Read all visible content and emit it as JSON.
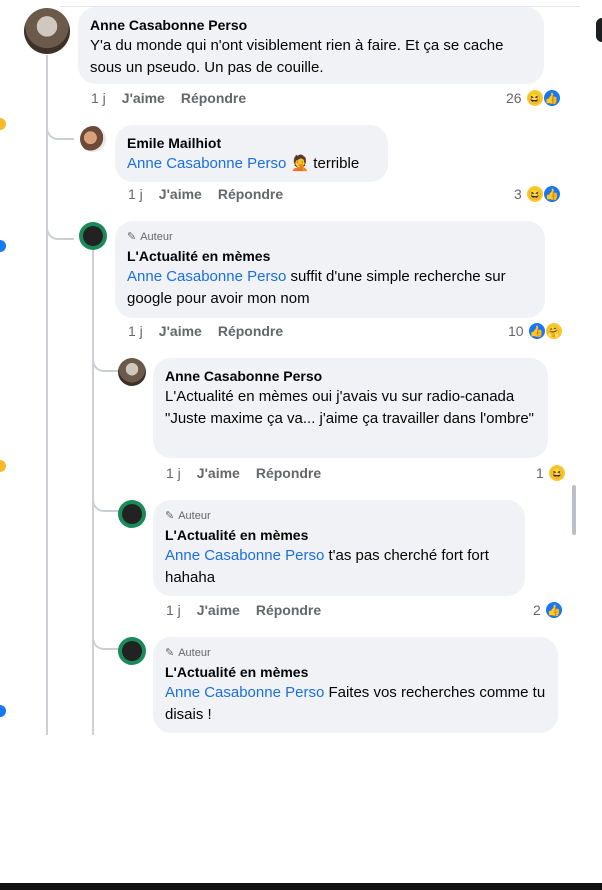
{
  "actions": {
    "like": "J'aime",
    "reply": "Répondre"
  },
  "author_badge": "Auteur",
  "comments": [
    {
      "name": "Anne Casabonne Perso",
      "mention": "",
      "text": "Y'a du monde qui n'ont visiblement rien à faire. Et ça se cache sous un pseudo.  Un pas de couille.",
      "time": "1 j",
      "count": "26",
      "reactions": [
        "haha",
        "like"
      ]
    },
    {
      "name": "Emile Mailhiot",
      "mention": "Anne Casabonne Perso",
      "emoji": "🤦",
      "text": " terrible",
      "time": "1 j",
      "count": "3",
      "reactions": [
        "haha",
        "like"
      ]
    },
    {
      "name": "L'Actualité en mèmes",
      "author": true,
      "mention": "Anne Casabonne Perso",
      "text": " suffit d'une simple recherche sur google pour avoir mon nom",
      "time": "1 j",
      "count": "10",
      "reactions": [
        "like",
        "care"
      ]
    },
    {
      "name": "Anne Casabonne Perso",
      "mention": "",
      "text": "L'Actualité en mèmes oui j'avais vu sur radio-canada \"Juste maxime ça va... j'aime ça travailler dans l'ombre\"",
      "time": "1 j",
      "count": "1",
      "reactions": [
        "haha"
      ]
    },
    {
      "name": "L'Actualité en mèmes",
      "author": true,
      "mention": "Anne Casabonne Perso",
      "text": " t'as pas cherché fort fort hahaha",
      "time": "1 j",
      "count": "2",
      "reactions": [
        "like"
      ]
    },
    {
      "name": "L'Actualité en mèmes",
      "author": true,
      "mention": "Anne Casabonne Perso",
      "text": " Faites vos recherches comme tu disais !"
    }
  ],
  "colors": {
    "mention": "#1b6fe0",
    "bubble": "#f0f2f5",
    "like": "#1877f2",
    "haha": "#f7c92e"
  }
}
